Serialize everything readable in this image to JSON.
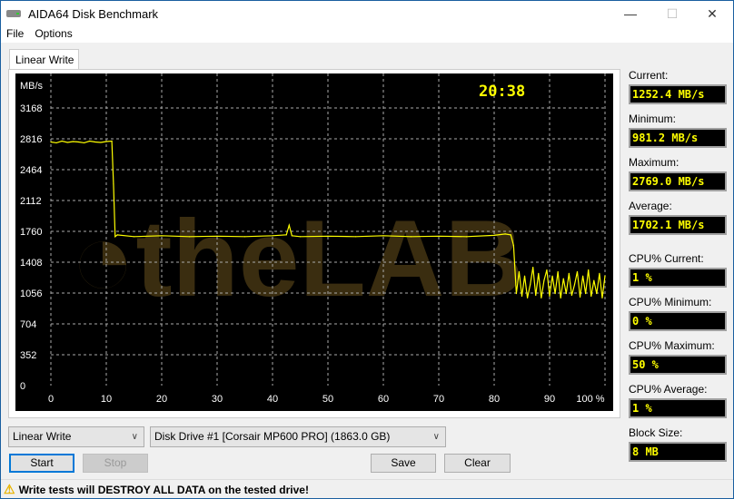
{
  "window": {
    "title": "AIDA64 Disk Benchmark",
    "minimize": "—",
    "maximize": "☐",
    "close": "✕"
  },
  "menu": [
    "File",
    "Options"
  ],
  "tab": "Linear Write",
  "stats": [
    {
      "label": "Current:",
      "value": "1252.4 MB/s"
    },
    {
      "label": "Minimum:",
      "value": "981.2 MB/s"
    },
    {
      "label": "Maximum:",
      "value": "2769.0 MB/s"
    },
    {
      "label": "Average:",
      "value": "1702.1 MB/s"
    },
    {
      "label": "CPU% Current:",
      "value": "1 %"
    },
    {
      "label": "CPU% Minimum:",
      "value": "0 %"
    },
    {
      "label": "CPU% Maximum:",
      "value": "50 %"
    },
    {
      "label": "CPU% Average:",
      "value": "1 %"
    },
    {
      "label": "Block Size:",
      "value": "8 MB"
    }
  ],
  "controls": {
    "test_select": "Linear Write",
    "drive_select": "Disk Drive #1  [Corsair MP600 PRO]  (1863.0 GB)",
    "start": "Start",
    "stop": "Stop",
    "save": "Save",
    "clear": "Clear"
  },
  "status": "Write tests will DESTROY ALL DATA on the tested drive!",
  "chart_data": {
    "type": "line",
    "ylabel": "MB/s",
    "timer": "20:38",
    "yticks": [
      0,
      352,
      704,
      1056,
      1408,
      1760,
      2112,
      2464,
      2816,
      3168
    ],
    "xticks": [
      "0",
      "10",
      "20",
      "30",
      "40",
      "50",
      "60",
      "70",
      "80",
      "90",
      "100 %"
    ],
    "xlim": [
      0,
      100
    ],
    "ylim": [
      0,
      3520
    ],
    "color": "#ffff00",
    "x": [
      0,
      1,
      2,
      3,
      4,
      5,
      6,
      7,
      8,
      9,
      10,
      11,
      11.3,
      11.6,
      12,
      15,
      20,
      25,
      30,
      35,
      40,
      42.5,
      43,
      43.5,
      45,
      50,
      55,
      60,
      65,
      70,
      75,
      80,
      82,
      83,
      83.5,
      84,
      84.5,
      85,
      85.5,
      86,
      86.5,
      87,
      87.5,
      88,
      88.5,
      89,
      89.5,
      90,
      90.5,
      91,
      91.5,
      92,
      92.5,
      93,
      93.5,
      94,
      94.5,
      95,
      95.5,
      96,
      96.5,
      97,
      97.5,
      98,
      98.5,
      99,
      99.5,
      100
    ],
    "y": [
      2780,
      2770,
      2790,
      2775,
      2785,
      2780,
      2770,
      2790,
      2780,
      2775,
      2785,
      2790,
      2300,
      1700,
      1720,
      1700,
      1710,
      1700,
      1705,
      1700,
      1710,
      1720,
      1830,
      1710,
      1700,
      1705,
      1700,
      1710,
      1700,
      1705,
      1700,
      1715,
      1730,
      1720,
      1600,
      1050,
      1300,
      1020,
      1250,
      1000,
      1150,
      1350,
      1030,
      1280,
      1000,
      1200,
      1320,
      1020,
      1250,
      1050,
      1300,
      1000,
      1220,
      1050,
      1280,
      1030,
      1150,
      1300,
      1010,
      1250,
      1050,
      1320,
      1020,
      1200,
      1050,
      1280,
      1000,
      1252
    ]
  }
}
